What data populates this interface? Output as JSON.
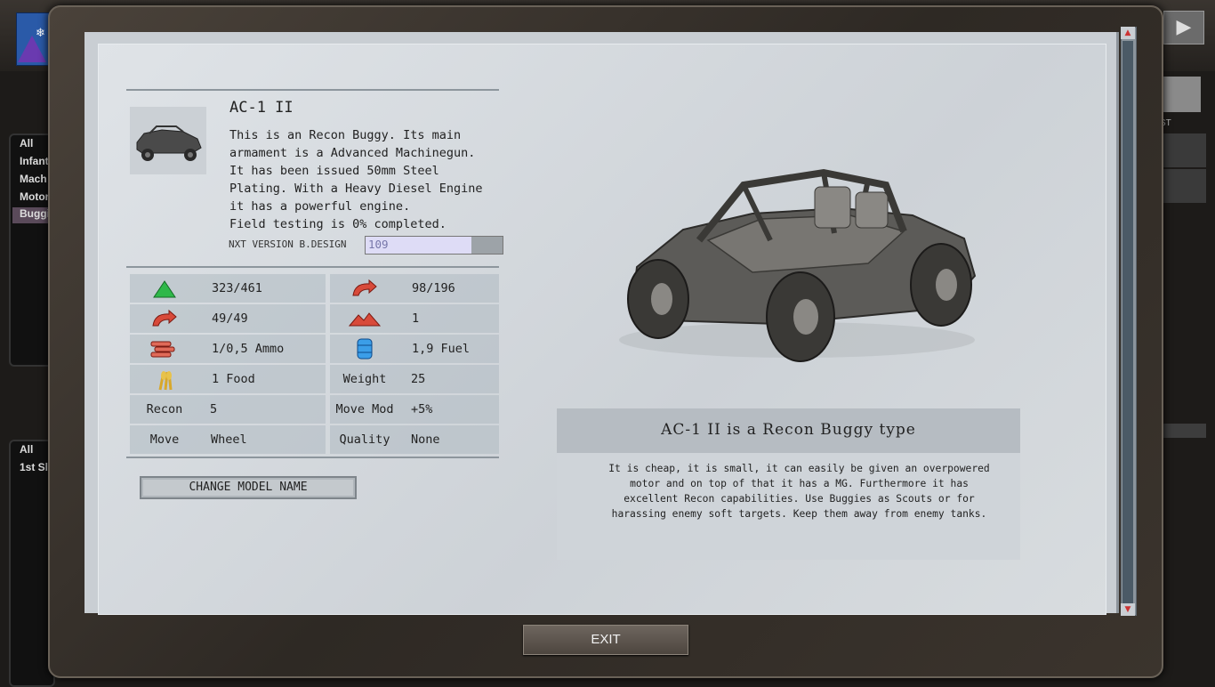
{
  "background": {
    "filters_top": [
      "All",
      "Infant",
      "Mach",
      "Motor",
      "Buggi"
    ],
    "filters_bottom": [
      "All",
      "1st Sl"
    ],
    "right_header": "ST"
  },
  "unit": {
    "name": "AC-1 II",
    "description_lines": [
      "This is an Recon Buggy. Its main",
      "armament is a Advanced Machinegun.",
      "It has been issued 50mm Steel",
      "Plating. With a Heavy Diesel Engine",
      "it has a powerful engine.",
      "Field testing is 0% completed."
    ],
    "nxt_label": "NXT VERSION B.DESIGN",
    "nxt_value": "109",
    "nxt_fraction": 0.77
  },
  "stats": {
    "hp": "323/461",
    "ap_right": "98/196",
    "ap_left": "49/49",
    "readiness": "1",
    "ammo": "1/0,5 Ammo",
    "fuel": "1,9 Fuel",
    "food": "1 Food",
    "weight_label": "Weight",
    "weight": "25",
    "recon_label": "Recon",
    "recon": "5",
    "movemod_label": "Move Mod",
    "movemod": "+5%",
    "move_label": "Move",
    "move": "Wheel",
    "quality_label": "Quality",
    "quality": "None"
  },
  "change_model_name": "CHANGE MODEL NAME",
  "type_info": {
    "title": "AC-1 II is a Recon Buggy type",
    "description_lines": [
      "It is cheap, it is small, it can easily be given an overpowered",
      "motor and on top of that it has a MG. Furthermore it has",
      "excellent Recon capabilities. Use Buggies as Scouts or for",
      "harassing enemy soft targets. Keep them away from enemy tanks."
    ]
  },
  "exit_label": "EXIT"
}
